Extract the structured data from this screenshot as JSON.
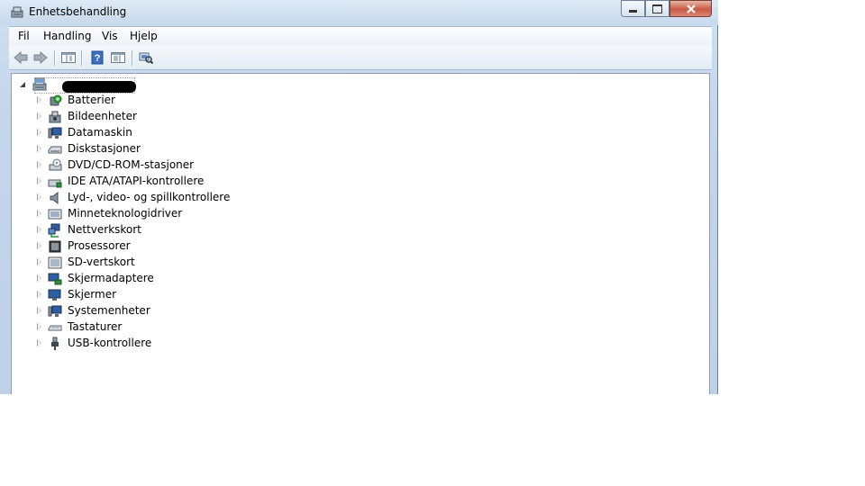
{
  "window": {
    "title": "Enhetsbehandling",
    "title_icon": "device-manager-icon",
    "controls": {
      "minimize": "minimize-icon",
      "maximize": "maximize-icon",
      "close": "close-icon"
    }
  },
  "menubar": {
    "items": [
      {
        "label": "Fil"
      },
      {
        "label": "Handling"
      },
      {
        "label": "Vis"
      },
      {
        "label": "Hjelp"
      }
    ]
  },
  "toolbar": {
    "buttons": [
      {
        "icon": "back-arrow-icon"
      },
      {
        "icon": "forward-arrow-icon"
      },
      {
        "icon": "show-hide-console-tree-icon"
      },
      {
        "icon": "help-icon"
      },
      {
        "icon": "properties-pane-icon"
      },
      {
        "icon": "scan-hardware-changes-icon"
      }
    ]
  },
  "tree": {
    "root": {
      "label": "",
      "redacted": true,
      "icon": "computer-icon"
    },
    "categories": [
      {
        "label": "Batterier",
        "icon": "battery-icon"
      },
      {
        "label": "Bildeenheter",
        "icon": "imaging-device-icon"
      },
      {
        "label": "Datamaskin",
        "icon": "computer-monitor-icon"
      },
      {
        "label": "Diskstasjoner",
        "icon": "disk-drive-icon"
      },
      {
        "label": "DVD/CD-ROM-stasjoner",
        "icon": "dvd-drive-icon"
      },
      {
        "label": "IDE ATA/ATAPI-kontrollere",
        "icon": "ide-controller-icon"
      },
      {
        "label": "Lyd-, video- og spillkontrollere",
        "icon": "speaker-icon"
      },
      {
        "label": "Minneteknologidriver",
        "icon": "memory-technology-icon"
      },
      {
        "label": "Nettverkskort",
        "icon": "network-adapter-icon"
      },
      {
        "label": "Prosessorer",
        "icon": "processor-icon"
      },
      {
        "label": "SD-vertskort",
        "icon": "sd-host-adapter-icon"
      },
      {
        "label": "Skjermadaptere",
        "icon": "display-adapter-icon"
      },
      {
        "label": "Skjermer",
        "icon": "monitor-icon"
      },
      {
        "label": "Systemenheter",
        "icon": "system-devices-icon"
      },
      {
        "label": "Tastaturer",
        "icon": "keyboard-icon"
      },
      {
        "label": "USB-kontrollere",
        "icon": "usb-controller-icon"
      }
    ]
  }
}
